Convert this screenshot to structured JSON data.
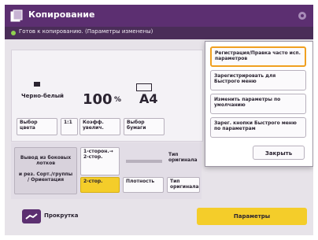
{
  "title": "Копирование",
  "status_text": "Готов к копированию. (Параметры изменены)",
  "summary": {
    "color_mode": "Черно-белый",
    "zoom": "100",
    "zoom_unit": "%",
    "paper": "A4"
  },
  "buttons_row1": [
    {
      "label": "Выбор цвета"
    },
    {
      "label": "1:1"
    },
    {
      "label": "Коэфф. увелич."
    },
    {
      "label": "Выбор бумаги"
    }
  ],
  "panel2": {
    "tray_label": "Вывод из боковых лотков",
    "orient_label": "и рез. Сорт./группы / Ориентация",
    "duplex_label": "1-сторон.→ 2-стор.",
    "duplex_value": "2-стор.",
    "density_label": "Плотность",
    "finishing_label": "Тип оригинала",
    "finishing_value": "Тип оригинала"
  },
  "bottom": {
    "preview_label": "Прокрутка",
    "settings_label": "Параметры"
  },
  "popup": {
    "items": [
      {
        "label": "Регистрация/Правка часто исп. параметров"
      },
      {
        "label": "Зарегистрировать для Быстрого меню"
      },
      {
        "label": "Изменить параметры по умолчанию"
      },
      {
        "label": "Зарег. кнопки Быстрого меню по параметрам"
      }
    ],
    "close_label": "Закрыть"
  }
}
